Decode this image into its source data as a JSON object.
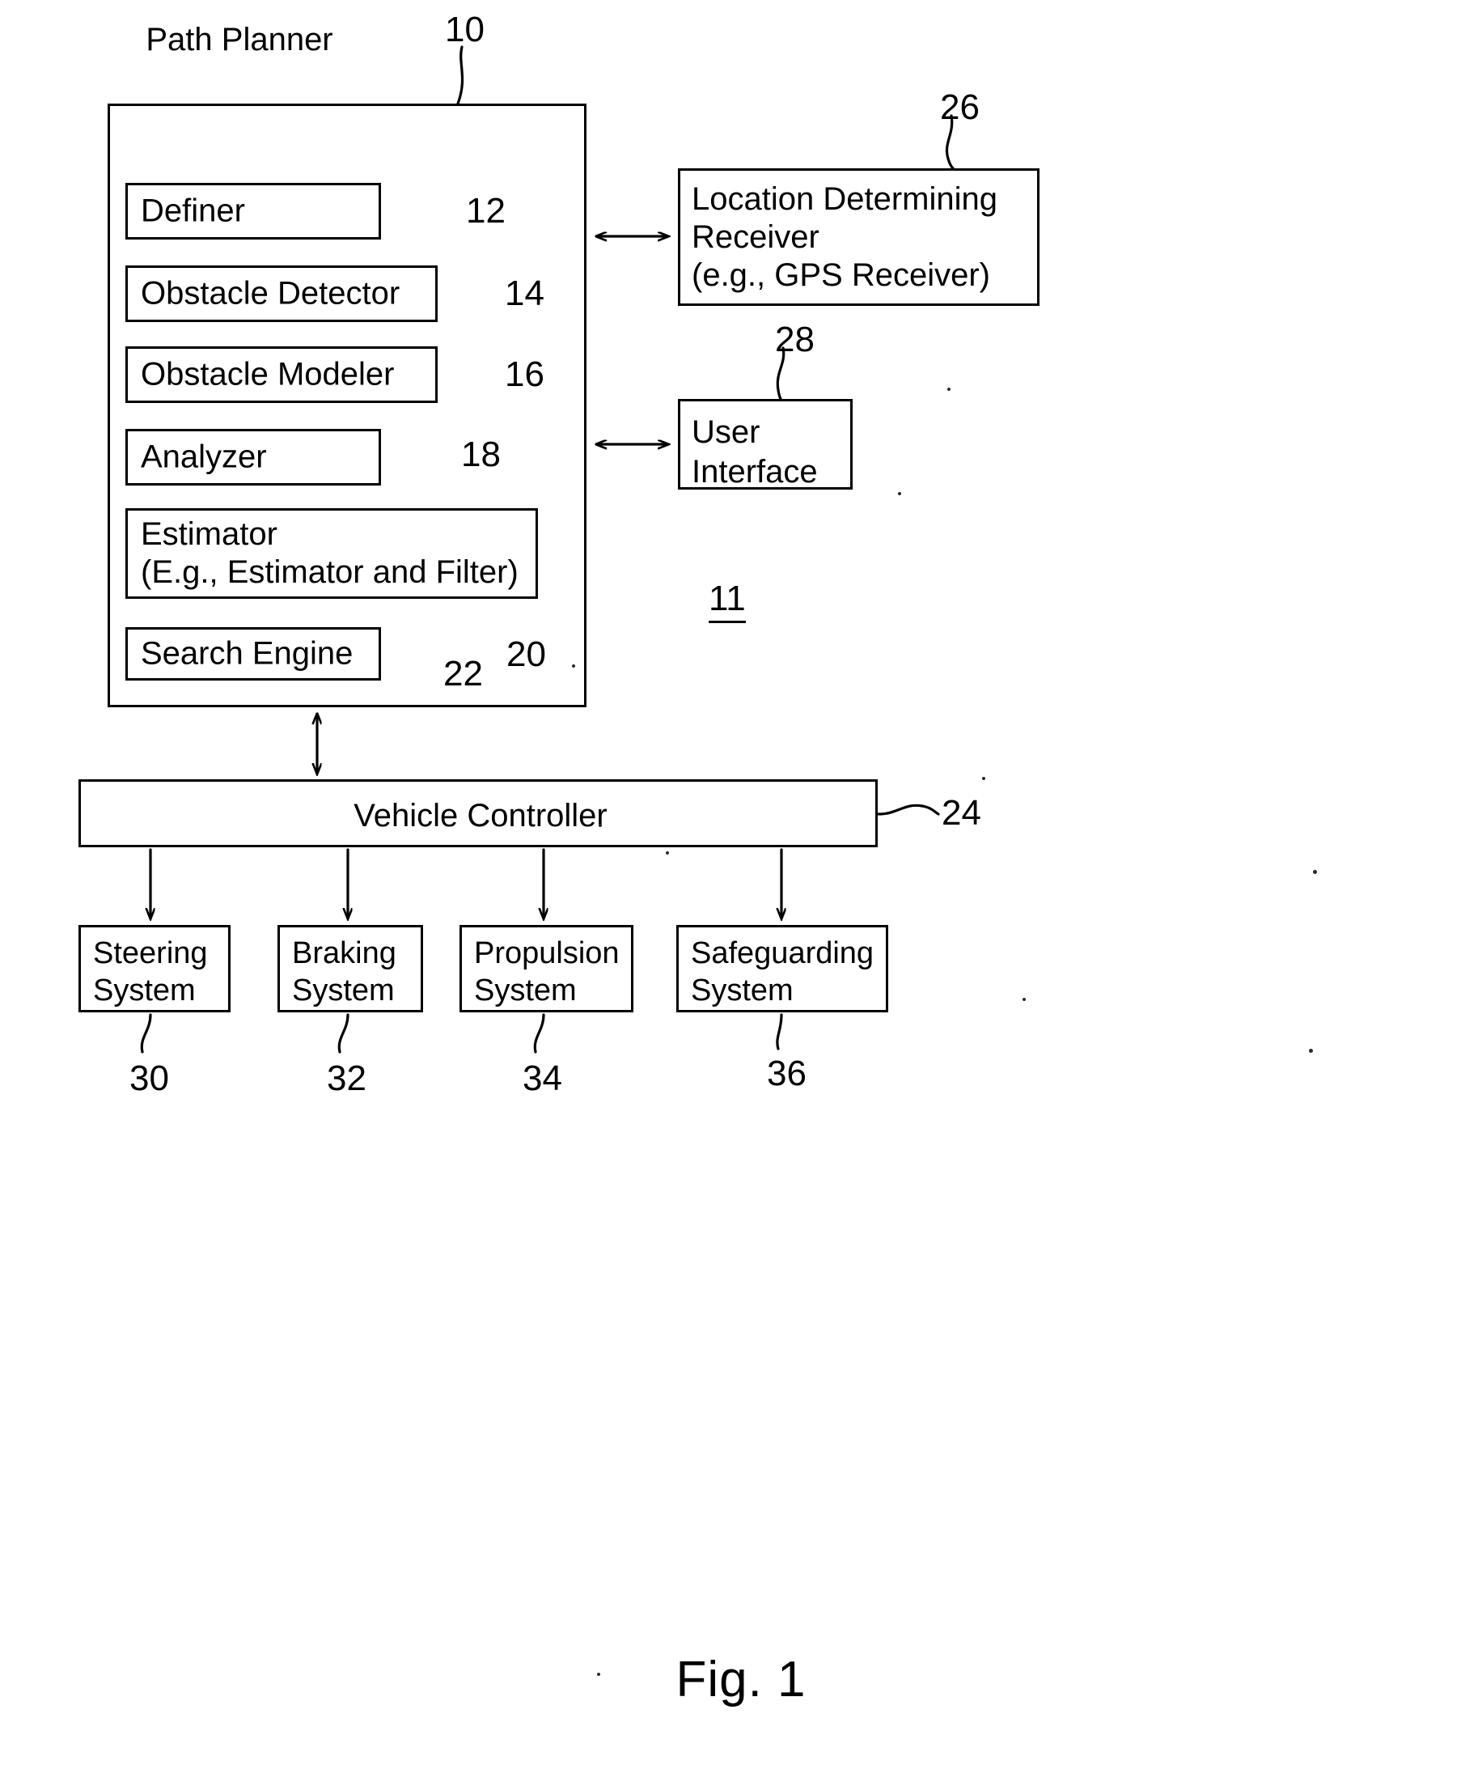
{
  "figure": {
    "caption": "Fig. 1",
    "system_numeral": "11"
  },
  "path_planner": {
    "title": "Path Planner",
    "numeral": "10",
    "modules": [
      {
        "label": "Definer",
        "numeral": "12"
      },
      {
        "label": "Obstacle Detector",
        "numeral": "14"
      },
      {
        "label": "Obstacle Modeler",
        "numeral": "16"
      },
      {
        "label": "Analyzer",
        "numeral": "18"
      },
      {
        "label": "Estimator\n(E.g., Estimator and Filter)",
        "numeral": "20"
      },
      {
        "label": "Search Engine",
        "numeral": "22"
      }
    ]
  },
  "peripherals": [
    {
      "label": "Location Determining\nReceiver\n(e.g., GPS Receiver)",
      "numeral": "26"
    },
    {
      "label": "User\nInterface",
      "numeral": "28"
    }
  ],
  "controller": {
    "label": "Vehicle Controller",
    "numeral": "24"
  },
  "subsystems": [
    {
      "label": "Steering\nSystem",
      "numeral": "30"
    },
    {
      "label": "Braking\nSystem",
      "numeral": "32"
    },
    {
      "label": "Propulsion\nSystem",
      "numeral": "34"
    },
    {
      "label": "Safeguarding\nSystem",
      "numeral": "36"
    }
  ],
  "colors": {
    "ink": "#000000",
    "paper": "#ffffff"
  }
}
